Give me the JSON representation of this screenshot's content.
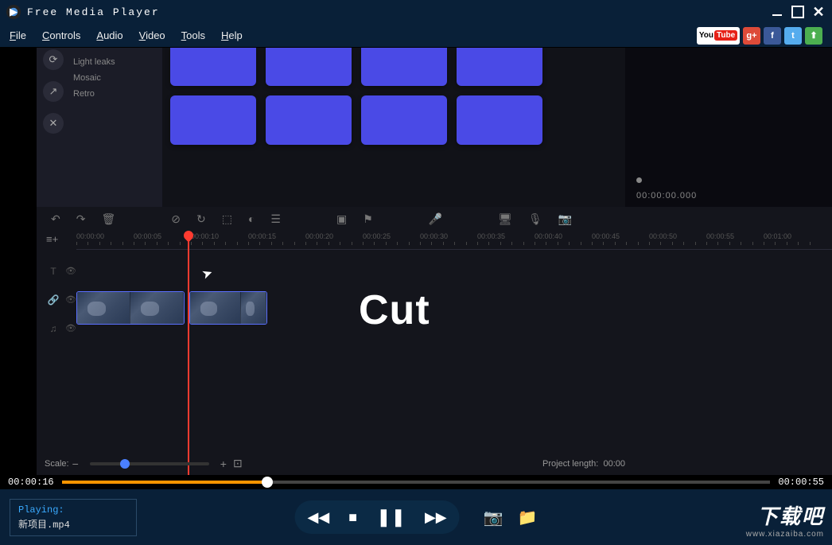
{
  "app_title": "Free Media Player",
  "menu": [
    "File",
    "Controls",
    "Audio",
    "Video",
    "Tools",
    "Help"
  ],
  "effects": [
    "Light leaks",
    "Mosaic",
    "Retro"
  ],
  "preview_time": "00:00:00.000",
  "ruler_labels": [
    "00:00:00",
    "00:00:05",
    "00:00:10",
    "00:00:15",
    "00:00:20",
    "00:00:25",
    "00:00:30",
    "00:00:35",
    "00:00:40",
    "00:00:45",
    "00:00:50",
    "00:00:55",
    "00:01:00"
  ],
  "big_text": "Cut",
  "scale_label": "Scale:",
  "project_length_label": "Project length:",
  "project_length_value": "00:00",
  "current_time": "00:00:16",
  "total_time": "00:00:55",
  "playing_label": "Playing:",
  "playing_file": "新项目.mp4",
  "watermark_big": "下载吧",
  "watermark_small": "www.xiazaiba.com",
  "youtube_text1": "You",
  "youtube_text2": "Tube"
}
